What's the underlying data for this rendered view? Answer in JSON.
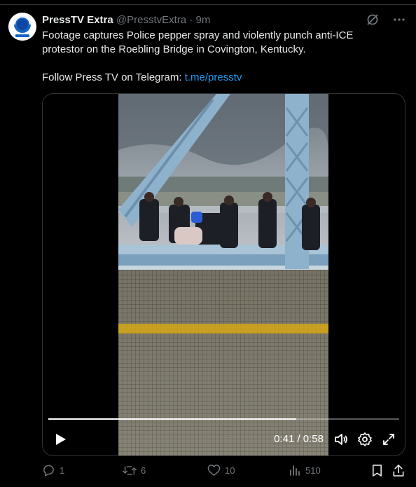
{
  "author": {
    "name": "PressTV Extra",
    "handle": "@PresstvExtra",
    "separator": "·",
    "time": "9m"
  },
  "post": {
    "text": "Footage captures Police pepper spray and violently punch anti-ICE protestor on the Roebling Bridge in Covington, Kentucky.",
    "follow_prefix": "Follow Press TV on Telegram: ",
    "follow_link": "t.me/presstv"
  },
  "video": {
    "current_time": "0:41",
    "duration": "0:58",
    "time_display": "0:41 / 0:58",
    "progress": 0.707
  },
  "actions": {
    "replies": "1",
    "reposts": "6",
    "likes": "10",
    "views": "510"
  },
  "colors": {
    "background": "#000000",
    "text": "#e7e9ea",
    "muted": "#71767b",
    "link": "#1d9bf0",
    "bridge_steel": "#8fb2cc",
    "safety_yellow": "#d6a817"
  },
  "icons": {
    "more": "more-icon",
    "grok": "grok-icon",
    "play": "play-icon",
    "volume": "volume-icon",
    "settings": "settings-icon",
    "fullscreen": "fullscreen-icon",
    "reply": "reply-icon",
    "repost": "repost-icon",
    "like": "like-icon",
    "views": "views-icon",
    "bookmark": "bookmark-icon",
    "share": "share-icon"
  }
}
